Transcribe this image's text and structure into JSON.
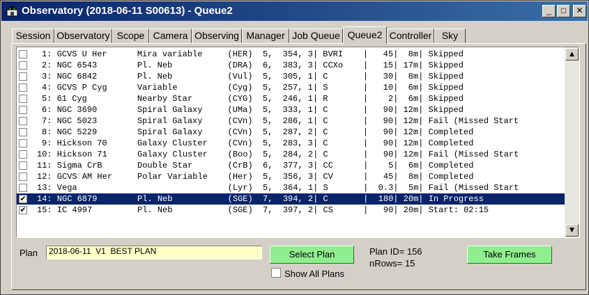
{
  "window": {
    "title": "Observatory (2018-06-11 S00613) - Queue2",
    "controls": {
      "minimize": "_",
      "maximize": "□",
      "close": "✕"
    }
  },
  "tabs": [
    "Session",
    "Observatory",
    "Scope",
    "Camera",
    "Observing",
    "Manager",
    "Job Queue",
    "Queue2",
    "Controller",
    "Sky"
  ],
  "active_tab": "Queue2",
  "queue": {
    "rows": [
      {
        "checked": false,
        "selected": false,
        "text": "1: GCVS U Her      Mira variable     (HER)  5,  354, 3| BVRI    |   45|  8m| Skipped"
      },
      {
        "checked": false,
        "selected": false,
        "text": "2: NGC 6543        Pl. Neb           (DRA)  6,  383, 3| CCXo    |   15| 17m| Skipped"
      },
      {
        "checked": false,
        "selected": false,
        "text": "3: NGC 6842        Pl. Neb           (Vul)  5,  305, 1| C       |   30|  8m| Skipped"
      },
      {
        "checked": false,
        "selected": false,
        "text": "4: GCVS P Cyg      Variable          (Cyg)  5,  257, 1| S       |   10|  6m| Skipped"
      },
      {
        "checked": false,
        "selected": false,
        "text": "5: 61 Cyg          Nearby Star       (CYG)  5,  246, 1| R       |    2|  6m| Skipped"
      },
      {
        "checked": false,
        "selected": false,
        "text": "6: NGC 3690        Spiral Galaxy     (UMa)  5,  333, 1| C       |   90| 12m| Skipped"
      },
      {
        "checked": false,
        "selected": false,
        "text": "7: NGC 5023        Spiral Galaxy     (CVn)  5,  286, 1| C       |   90| 12m| Fail (Missed Start"
      },
      {
        "checked": false,
        "selected": false,
        "text": "8: NGC 5229        Spiral Galaxy     (CVn)  5,  287, 2| C       |   90| 12m| Completed"
      },
      {
        "checked": false,
        "selected": false,
        "text": "9: Hickson 70      Galaxy Cluster    (CVn)  5,  283, 3| C       |   90| 12m| Completed"
      },
      {
        "checked": false,
        "selected": false,
        "text": "10: Hickson 71      Galaxy Cluster    (Boo)  5,  284, 2| C       |   90| 12m| Fail (Missed Start"
      },
      {
        "checked": false,
        "selected": false,
        "text": "11: Sigma CrB       Double Star       (CrB)  6,  377, 3| CC      |    5|  6m| Completed"
      },
      {
        "checked": false,
        "selected": false,
        "text": "12: GCVS AM Her     Polar Variable    (Her)  5,  356, 3| CV      |   45|  8m| Completed"
      },
      {
        "checked": false,
        "selected": false,
        "text": "13: Vega                              (Lyr)  5,  364, 1| S       |  0.3|  5m| Fail (Missed Start"
      },
      {
        "checked": true,
        "selected": true,
        "text": "14: NGC 6879        Pl. Neb           (SGE)  7,  394, 2| C       |  180| 20m| In Progress"
      },
      {
        "checked": true,
        "selected": false,
        "text": "15: IC 4997         Pl. Neb           (SGE)  7,  397, 2| CS      |   90| 20m| Start: 02:15"
      }
    ]
  },
  "plan": {
    "label": "Plan",
    "value": "2018-06-11  V1  BEST PLAN",
    "select_button": "Select Plan",
    "show_all_label": "Show All Plans",
    "show_all_checked": false,
    "plan_id": "Plan ID= 156",
    "nrows": "nRows= 15",
    "take_frames_button": "Take Frames"
  },
  "colors": {
    "selection": "#0a246a",
    "title_bar": "#0a246a",
    "button_green": "#90ee90",
    "plan_field": "#ffffc8"
  }
}
